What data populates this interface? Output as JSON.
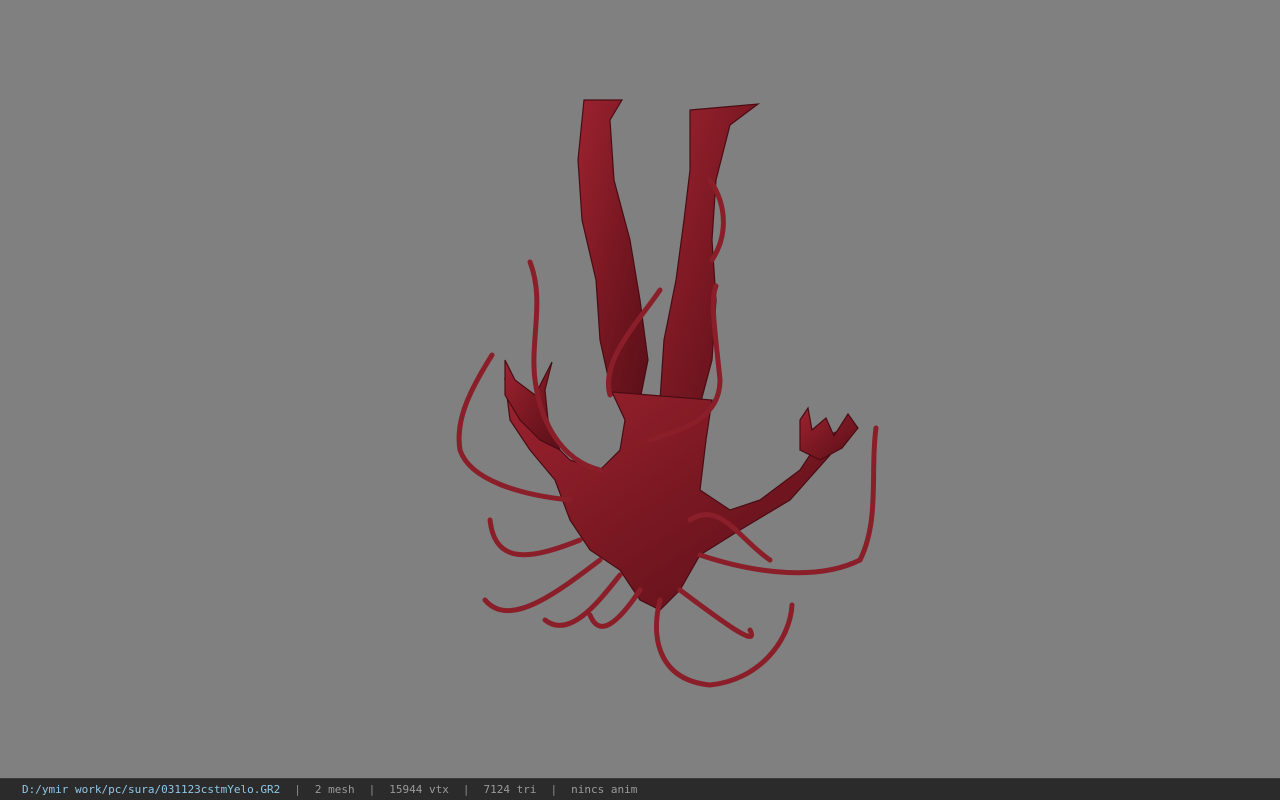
{
  "viewport": {
    "background_color": "#808080",
    "model_color": "#8a1f2a"
  },
  "status_bar": {
    "file_path": "D:/ymir work/pc/sura/031123cstmYelo.GR2",
    "separator": "|",
    "mesh_count": "2 mesh",
    "vertex_count": "15944 vtx",
    "triangle_count": "7124 tri",
    "animation": "nincs anim"
  }
}
